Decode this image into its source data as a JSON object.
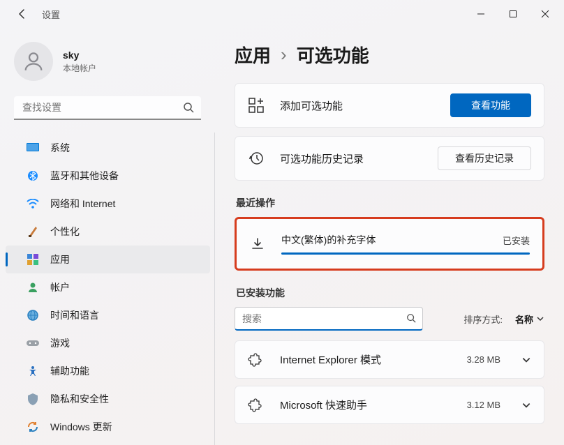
{
  "app_title": "设置",
  "profile": {
    "name": "sky",
    "type": "本地帐户"
  },
  "search_placeholder": "查找设置",
  "nav": [
    {
      "key": "system",
      "label": "系统"
    },
    {
      "key": "bluetooth",
      "label": "蓝牙和其他设备"
    },
    {
      "key": "network",
      "label": "网络和 Internet"
    },
    {
      "key": "personalization",
      "label": "个性化"
    },
    {
      "key": "apps",
      "label": "应用"
    },
    {
      "key": "accounts",
      "label": "帐户"
    },
    {
      "key": "time",
      "label": "时间和语言"
    },
    {
      "key": "gaming",
      "label": "游戏"
    },
    {
      "key": "accessibility",
      "label": "辅助功能"
    },
    {
      "key": "privacy",
      "label": "隐私和安全性"
    },
    {
      "key": "update",
      "label": "Windows 更新"
    }
  ],
  "breadcrumb": {
    "parent": "应用",
    "current": "可选功能"
  },
  "add_card": {
    "label": "添加可选功能",
    "button": "查看功能"
  },
  "history_card": {
    "label": "可选功能历史记录",
    "button": "查看历史记录"
  },
  "recent_section": "最近操作",
  "recent_item": {
    "name": "中文(繁体)的补充字体",
    "status": "已安装"
  },
  "installed_section": "已安装功能",
  "filter_placeholder": "搜索",
  "sort": {
    "label": "排序方式:",
    "value": "名称"
  },
  "installed": [
    {
      "name": "Internet Explorer 模式",
      "size": "3.28 MB"
    },
    {
      "name": "Microsoft 快速助手",
      "size": "3.12 MB"
    }
  ]
}
